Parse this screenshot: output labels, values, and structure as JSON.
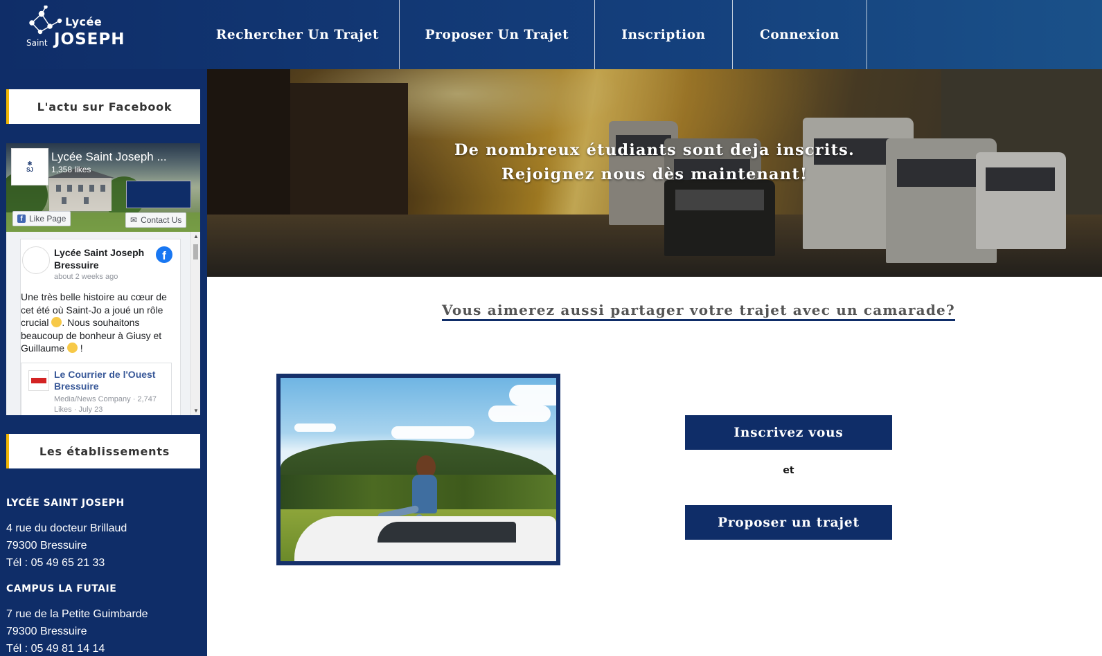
{
  "header": {
    "logo": {
      "line1": "Lycée",
      "line2a": "Saint",
      "line2b": "JOSEPH"
    },
    "nav": [
      {
        "label": "Rechercher Un Trajet"
      },
      {
        "label": "Proposer Un Trajet"
      },
      {
        "label": "Inscription"
      },
      {
        "label": "Connexion"
      }
    ]
  },
  "sidebar": {
    "facebook_heading": "L'actu sur Facebook",
    "facebook": {
      "page_name": "Lycée Saint Joseph ...",
      "likes": "1,358 likes",
      "like_button": "Like Page",
      "contact_button": "Contact Us",
      "post": {
        "author": "Lycée Saint Joseph Bressuire",
        "time": "about 2 weeks ago",
        "text_1": "Une très belle histoire au cœur de cet été où Saint-Jo a joué un rôle crucial ",
        "text_2": ". Nous souhaitons beaucoup de bonheur à Giusy et Guillaume ",
        "text_3": " !",
        "link_title": "Le Courrier de l'Ouest Bressuire",
        "link_sub": "Media/News Company · 2,747 Likes · July 23"
      }
    },
    "etablissements_heading": "Les établissements",
    "etablissements": [
      {
        "name": "LYCÉE SAINT JOSEPH",
        "street": "4 rue du docteur Brillaud",
        "city": "79300 Bressuire",
        "phone": "Tél : 05 49 65 21 33"
      },
      {
        "name": "CAMPUS LA FUTAIE",
        "street": "7 rue de la Petite Guimbarde",
        "city": "79300 Bressuire",
        "phone": "Tél : 05 49 81 14 14"
      }
    ]
  },
  "hero": {
    "line1": "De nombreux étudiants sont deja inscrits.",
    "line2": "Rejoignez nous dès maintenant!"
  },
  "main": {
    "share_title": "Vous aimerez aussi partager votre trajet avec un camarade?",
    "register_button": "Inscrivez vous",
    "conjunction": "et",
    "propose_button": "Proposer un trajet"
  },
  "colors": {
    "primary": "#0f2d68",
    "accent": "#f2b705"
  }
}
